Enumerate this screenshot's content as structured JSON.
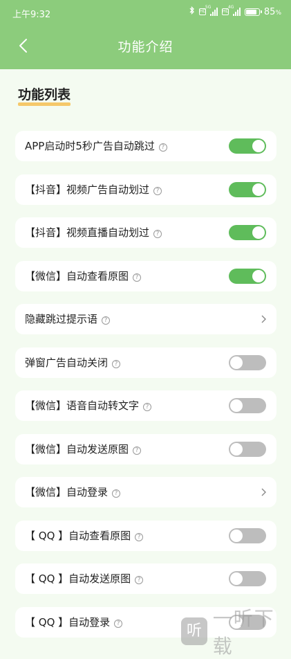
{
  "status_bar": {
    "time": "上午9:32",
    "network1": "5G",
    "network2": "4G",
    "battery": "85",
    "battery_unit": "%"
  },
  "nav": {
    "back_icon": "chevron-left-icon",
    "title": "功能介绍"
  },
  "section": {
    "title": "功能列表"
  },
  "rows": [
    {
      "label": "APP启动时5秒广告自动跳过",
      "control": "toggle",
      "on": true
    },
    {
      "label": "【抖音】视频广告自动划过",
      "control": "toggle",
      "on": true
    },
    {
      "label": "【抖音】视频直播自动划过",
      "control": "toggle",
      "on": true
    },
    {
      "label": "【微信】自动查看原图",
      "control": "toggle",
      "on": true
    },
    {
      "label": "隐藏跳过提示语",
      "control": "chevron"
    },
    {
      "label": "弹窗广告自动关闭",
      "control": "toggle",
      "on": false
    },
    {
      "label": "【微信】语音自动转文字",
      "control": "toggle",
      "on": false
    },
    {
      "label": "【微信】自动发送原图",
      "control": "toggle",
      "on": false
    },
    {
      "label": "【微信】自动登录",
      "control": "chevron"
    },
    {
      "label": "【 QQ 】自动查看原图",
      "control": "toggle",
      "on": false
    },
    {
      "label": "【 QQ 】自动发送原图",
      "control": "toggle",
      "on": false
    },
    {
      "label": "【 QQ 】自动登录",
      "control": "toggle",
      "on": false
    }
  ],
  "help_glyph": "?",
  "watermark": {
    "logo_glyph": "听",
    "text": "一听下载"
  },
  "colors": {
    "header": "#8ccc7c",
    "toggle_on": "#5fbc5b",
    "toggle_off": "#bdbdbd",
    "underline": "#f5c86a",
    "background": "#f4fbf1"
  }
}
